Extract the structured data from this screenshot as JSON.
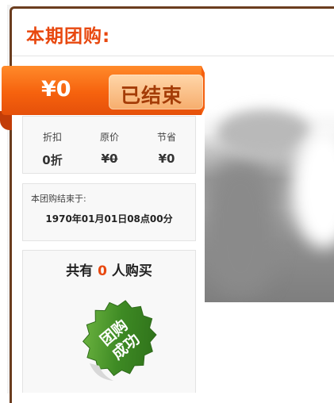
{
  "header": {
    "title": "本期团购:"
  },
  "deal": {
    "price": "¥0",
    "status": "已结束"
  },
  "stats": [
    {
      "label": "折扣",
      "value": "0折"
    },
    {
      "label": "原价",
      "value": "¥0"
    },
    {
      "label": "节省",
      "value": "¥0"
    }
  ],
  "end_time": {
    "label": "本团购结束于:",
    "value": "1970年01月01日08点00分"
  },
  "buyers": {
    "prefix": "共有",
    "count": "0",
    "suffix": "人购买"
  },
  "badge": {
    "text": "团购成功",
    "color": "#3e8a24"
  },
  "colors": {
    "accent": "#e8480f",
    "frame": "#6b3d1f",
    "ribbon": "#f6620e"
  }
}
